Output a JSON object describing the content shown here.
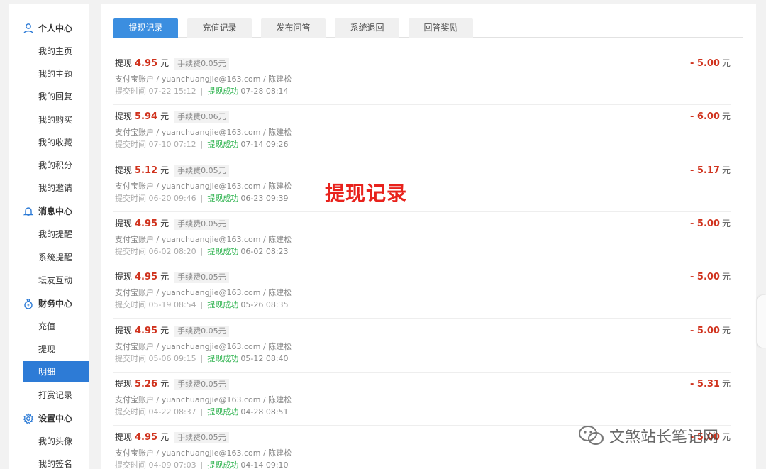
{
  "sidebar": {
    "sections": [
      {
        "title": "个人中心",
        "icon": "user-icon",
        "items": [
          "我的主页",
          "我的主题",
          "我的回复",
          "我的购买",
          "我的收藏",
          "我的积分",
          "我的邀请"
        ]
      },
      {
        "title": "消息中心",
        "icon": "bell-icon",
        "items": [
          "我的提醒",
          "系统提醒",
          "坛友互动"
        ]
      },
      {
        "title": "财务中心",
        "icon": "money-bag-icon",
        "items": [
          "充值",
          "提现",
          "明细",
          "打赏记录"
        ]
      },
      {
        "title": "设置中心",
        "icon": "gear-icon",
        "items": [
          "我的头像",
          "我的签名"
        ]
      }
    ],
    "active_item": "明细"
  },
  "tabs": [
    "提现记录",
    "充值记录",
    "发布问答",
    "系统退回",
    "回答奖励"
  ],
  "active_tab": "提现记录",
  "record_labels": {
    "type": "提现",
    "unit": "元",
    "submit_label": "提交时间",
    "success_label": "提现成功",
    "separator": "|"
  },
  "records": [
    {
      "amount": "4.95",
      "fee": "手续费0.05元",
      "account": "支付宝账户 / yuanchuangjie@163.com / 陈建松",
      "submit_time": "07-22 15:12",
      "success_time": "07-28 08:14",
      "total": "- 5.00"
    },
    {
      "amount": "5.94",
      "fee": "手续费0.06元",
      "account": "支付宝账户 / yuanchuangjie@163.com / 陈建松",
      "submit_time": "07-10 07:12",
      "success_time": "07-14 09:26",
      "total": "- 6.00"
    },
    {
      "amount": "5.12",
      "fee": "手续费0.05元",
      "account": "支付宝账户 / yuanchuangjie@163.com / 陈建松",
      "submit_time": "06-20 09:46",
      "success_time": "06-23 09:39",
      "total": "- 5.17"
    },
    {
      "amount": "4.95",
      "fee": "手续费0.05元",
      "account": "支付宝账户 / yuanchuangjie@163.com / 陈建松",
      "submit_time": "06-02 08:20",
      "success_time": "06-02 08:23",
      "total": "- 5.00"
    },
    {
      "amount": "4.95",
      "fee": "手续费0.05元",
      "account": "支付宝账户 / yuanchuangjie@163.com / 陈建松",
      "submit_time": "05-19 08:54",
      "success_time": "05-26 08:35",
      "total": "- 5.00"
    },
    {
      "amount": "4.95",
      "fee": "手续费0.05元",
      "account": "支付宝账户 / yuanchuangjie@163.com / 陈建松",
      "submit_time": "05-06 09:15",
      "success_time": "05-12 08:40",
      "total": "- 5.00"
    },
    {
      "amount": "5.26",
      "fee": "手续费0.05元",
      "account": "支付宝账户 / yuanchuangjie@163.com / 陈建松",
      "submit_time": "04-22 08:37",
      "success_time": "04-28 08:51",
      "total": "- 5.31"
    },
    {
      "amount": "4.95",
      "fee": "手续费0.05元",
      "account": "支付宝账户 / yuanchuangjie@163.com / 陈建松",
      "submit_time": "04-09 07:03",
      "success_time": "04-14 09:10",
      "total": "- 5.00"
    }
  ],
  "overlay_title": "提现记录",
  "watermark": "文煞站长笔记网",
  "colors": {
    "accent": "#3b8ee0",
    "active_side": "#2d7bd6",
    "amount_red": "#d0331e",
    "success_green": "#2bb24c",
    "overlay_red": "#e8221c"
  }
}
